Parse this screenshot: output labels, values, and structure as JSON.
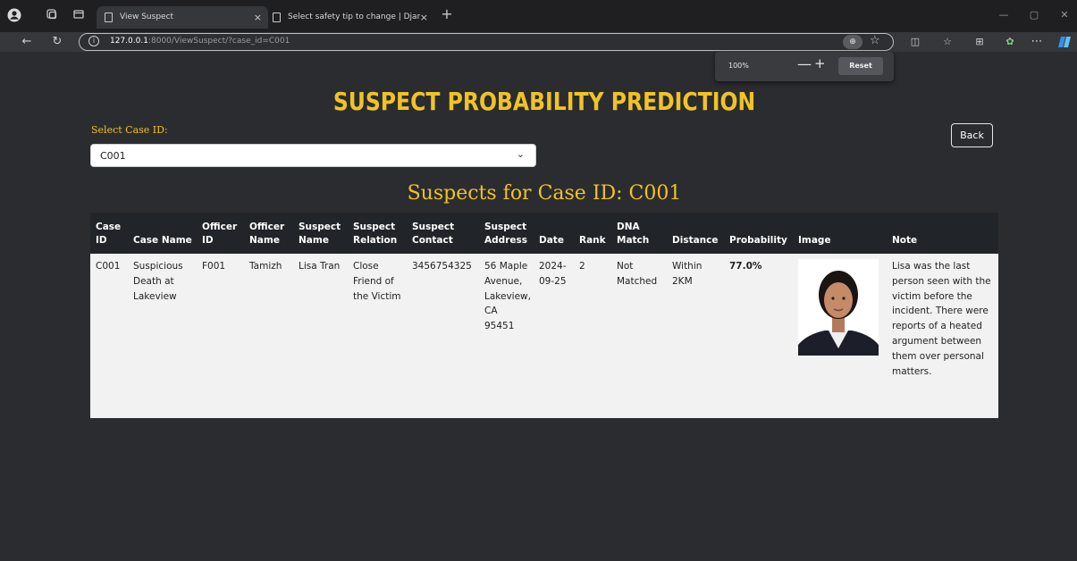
{
  "browser": {
    "tabs": [
      {
        "label": "View Suspect",
        "close": "×"
      },
      {
        "label": "Select safety tip to change | Djan",
        "close": "×"
      }
    ],
    "new_tab": "+",
    "url_host": "127.0.0.1",
    "url_path": ":8000/ViewSuspect/?case_id=C001",
    "zoom_popup": {
      "level": "100%",
      "minus": "—",
      "plus": "+",
      "reset": "Reset"
    }
  },
  "page": {
    "title": "SUSPECT PROBABILITY PREDICTION",
    "select_label": "Select Case ID:",
    "selected_case": "C001",
    "back_label": "Back",
    "heading": "Suspects for Case ID: C001"
  },
  "table": {
    "headers": [
      "Case ID",
      "Case Name",
      "Officer ID",
      "Officer Name",
      "Suspect Name",
      "Suspect Relation",
      "Suspect Contact",
      "Suspect Address",
      "Date",
      "Rank",
      "DNA Match",
      "Distance",
      "Probability",
      "Image",
      "Note"
    ],
    "rows": [
      {
        "case_id": "C001",
        "case_name": "Suspicious Death at Lakeview",
        "officer_id": "F001",
        "officer_name": "Tamizh",
        "suspect_name": "Lisa Tran",
        "relation": "Close Friend of the Victim",
        "contact": "3456754325",
        "address": "56 Maple Avenue, Lakeview, CA 95451",
        "date": "2024-09-25",
        "rank": "2",
        "dna_match": "Not Matched",
        "distance": "Within 2KM",
        "probability": "77.0%",
        "note": "Lisa was the last person seen with the victim before the incident. There were reports of a heated argument between them over personal matters."
      }
    ]
  },
  "colors": {
    "accent": "#f0c326",
    "background": "#2b2c30",
    "table_header": "#212529",
    "table_row": "#f2f2f2"
  }
}
